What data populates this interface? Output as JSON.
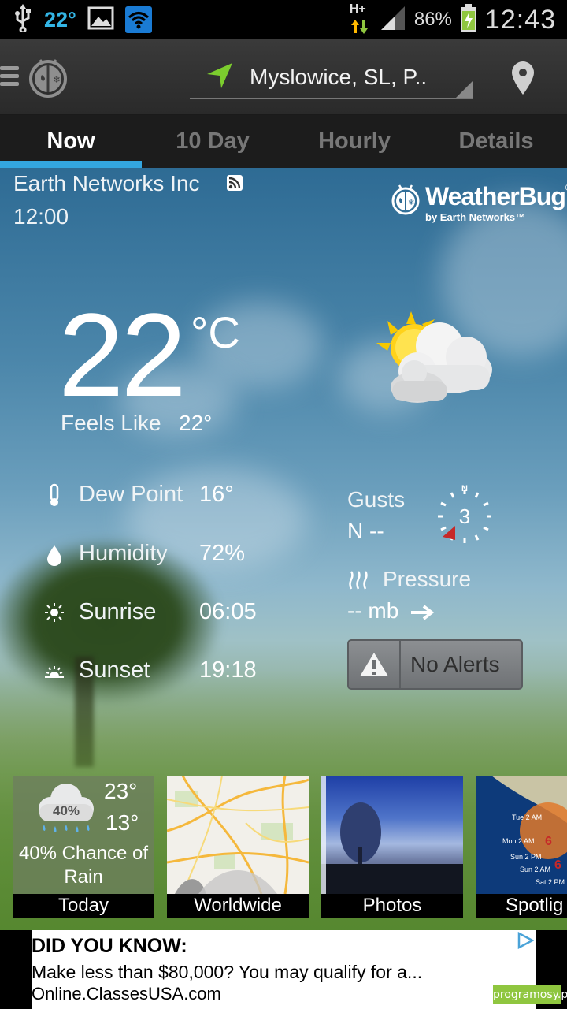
{
  "statusbar": {
    "temp": "22°",
    "network": "H+",
    "battery_pct": "86%",
    "time": "12:43",
    "icons": [
      "usb-icon",
      "image-icon",
      "wifi-icon",
      "signal-icon",
      "battery-charging-icon"
    ]
  },
  "header": {
    "location": "Myslowice, SL, P..",
    "icons": [
      "menu-icon",
      "weatherbug-logo-icon",
      "location-arrow-icon",
      "map-pin-icon"
    ]
  },
  "tabs": [
    {
      "label": "Now",
      "active": true
    },
    {
      "label": "10 Day",
      "active": false
    },
    {
      "label": "Hourly",
      "active": false
    },
    {
      "label": "Details",
      "active": false
    }
  ],
  "current": {
    "provider": "Earth Networks Inc",
    "obs_time": "12:00",
    "temperature": "22",
    "unit": "°C",
    "feels_label": "Feels Like",
    "feels_value": "22°",
    "brand": {
      "title": "WeatherBug",
      "tm": "®",
      "sub": "by Earth Networks™"
    },
    "condition_icon": "partly-cloudy-icon",
    "stats": [
      {
        "label": "Dew Point",
        "value": "16°",
        "icon": "thermometer-icon"
      },
      {
        "label": "Humidity",
        "value": "72%",
        "icon": "droplet-icon"
      },
      {
        "label": "Sunrise",
        "value": "06:05",
        "icon": "sun-icon"
      },
      {
        "label": "Sunset",
        "value": "19:18",
        "icon": "sunset-icon"
      }
    ],
    "gusts": {
      "label": "Gusts",
      "value": "N --",
      "wind_speed": "3",
      "compass_dir": "N"
    },
    "pressure": {
      "label": "Pressure",
      "value": "-- mb"
    },
    "alerts": {
      "label": "No Alerts"
    }
  },
  "cards": [
    {
      "label": "Today",
      "hi": "23°",
      "lo": "13°",
      "pop_badge": "40%",
      "chance": "40% Chance of Rain"
    },
    {
      "label": "Worldwide"
    },
    {
      "label": "Photos"
    },
    {
      "label": "Spotlig",
      "map_labels": [
        "Tue 2 AM",
        "Mon 2 AM",
        "Sun 2 PM",
        "Sun 2 AM",
        "Sat 2 PM"
      ]
    }
  ],
  "ad": {
    "headline": "DID YOU KNOW:",
    "body": "Make less than $80,000? You may qualify for a...",
    "url": "Online.ClassesUSA.com"
  },
  "watermark": "programosy.pl",
  "colors": {
    "accent": "#33a6e0",
    "status_temp": "#33b5e5",
    "location_arrow": "#7ccd2e"
  }
}
